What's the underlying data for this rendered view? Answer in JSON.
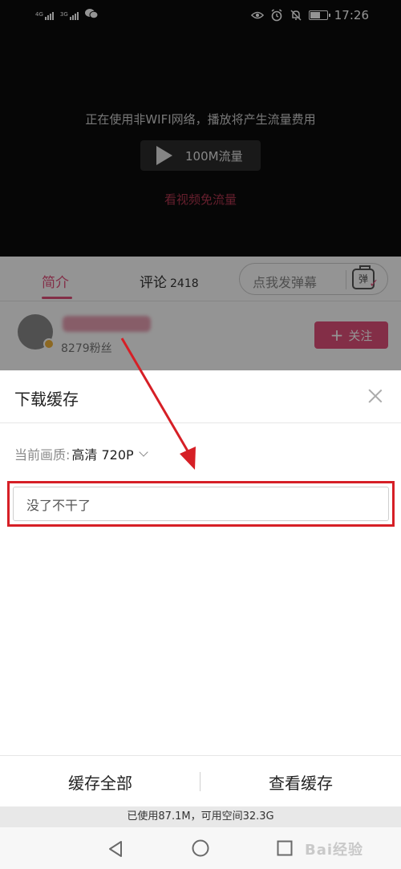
{
  "status_bar": {
    "left_labels": [
      "4G",
      "3G"
    ],
    "time": "17:26",
    "battery_level": 0.65
  },
  "video": {
    "network_warning": "正在使用非WIFI网络，播放将产生流量费用",
    "play_button_label": "100M流量",
    "free_flow_link": "看视频免流量"
  },
  "tabs": {
    "intro": "简介",
    "comment": "评论",
    "comment_count": "2418",
    "danmaku_placeholder": "点我发弹幕",
    "danmaku_icon_text": "弹"
  },
  "uploader": {
    "fans": "8279粉丝",
    "follow_label": "关注"
  },
  "download_sheet": {
    "title": "下载缓存",
    "quality_label": "当前画质:",
    "quality_value": "高清 720P",
    "episode_title": "没了不干了",
    "cache_all": "缓存全部",
    "view_cache": "查看缓存",
    "storage_info": "已使用87.1M，可用空间32.3G"
  },
  "watermark": "Bai经验",
  "colors": {
    "accent": "#e2507b",
    "annotation_red": "#d61f26"
  }
}
